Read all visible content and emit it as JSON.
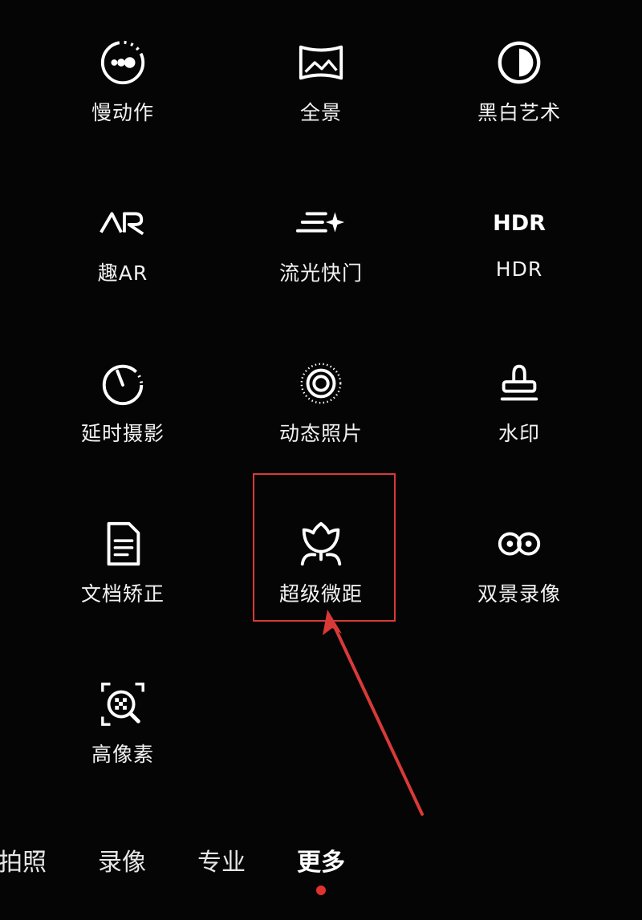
{
  "modes": [
    {
      "id": "slow-motion",
      "label": "慢动作",
      "icon": "slow-motion-icon"
    },
    {
      "id": "panorama",
      "label": "全景",
      "icon": "panorama-icon"
    },
    {
      "id": "monochrome-art",
      "label": "黑白艺术",
      "icon": "monochrome-icon"
    },
    {
      "id": "fun-ar",
      "label": "趣AR",
      "icon": "ar-icon",
      "glyph": "AR"
    },
    {
      "id": "light-painting",
      "label": "流光快门",
      "icon": "light-painting-icon"
    },
    {
      "id": "hdr",
      "label": "HDR",
      "icon": "hdr-icon",
      "glyph": "HDR"
    },
    {
      "id": "time-lapse",
      "label": "延时摄影",
      "icon": "timer-icon"
    },
    {
      "id": "moving-picture",
      "label": "动态照片",
      "icon": "live-photo-icon"
    },
    {
      "id": "watermark",
      "label": "水印",
      "icon": "stamp-icon"
    },
    {
      "id": "document-correction",
      "label": "文档矫正",
      "icon": "document-icon"
    },
    {
      "id": "super-macro",
      "label": "超级微距",
      "icon": "tulip-icon"
    },
    {
      "id": "dual-view-video",
      "label": "双景录像",
      "icon": "dual-view-icon"
    },
    {
      "id": "high-res",
      "label": "高像素",
      "icon": "high-res-icon"
    }
  ],
  "tabs": [
    {
      "label": "拍照"
    },
    {
      "label": "录像"
    },
    {
      "label": "专业"
    },
    {
      "label": "更多",
      "active": true
    }
  ],
  "colors": {
    "background": "#050505",
    "text": "#ffffff",
    "highlight": "#d93a38",
    "active_dot": "#e0312e"
  }
}
